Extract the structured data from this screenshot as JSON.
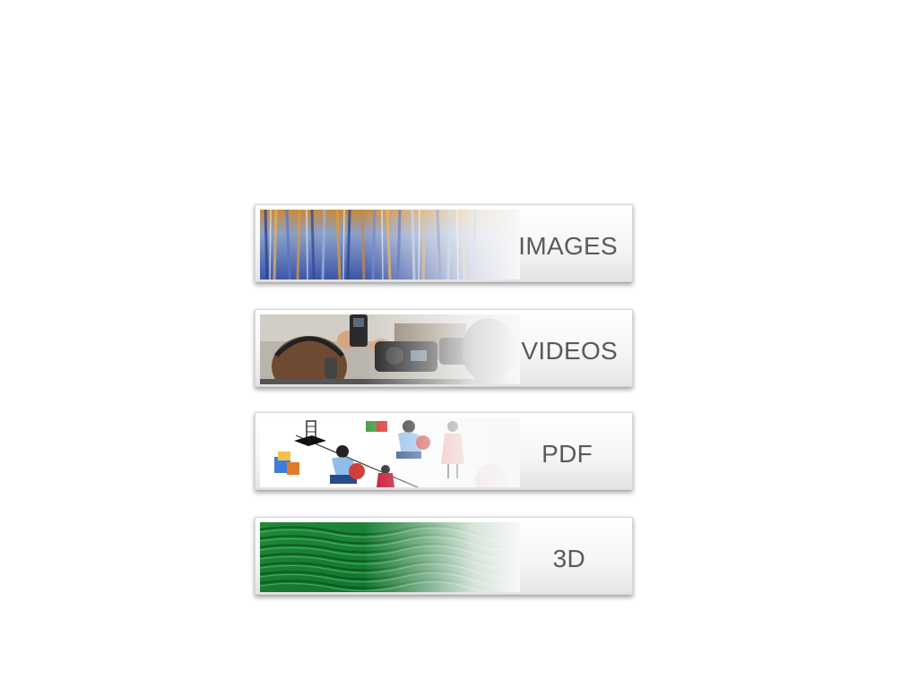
{
  "menu": {
    "items": [
      {
        "label": "IMAGES",
        "thumbnail": "blue-orange-abstract-texture"
      },
      {
        "label": "VIDEOS",
        "thumbnail": "camera-recording-scene"
      },
      {
        "label": "PDF",
        "thumbnail": "people-illustration"
      },
      {
        "label": "3D",
        "thumbnail": "green-sand-dune-texture"
      }
    ]
  }
}
